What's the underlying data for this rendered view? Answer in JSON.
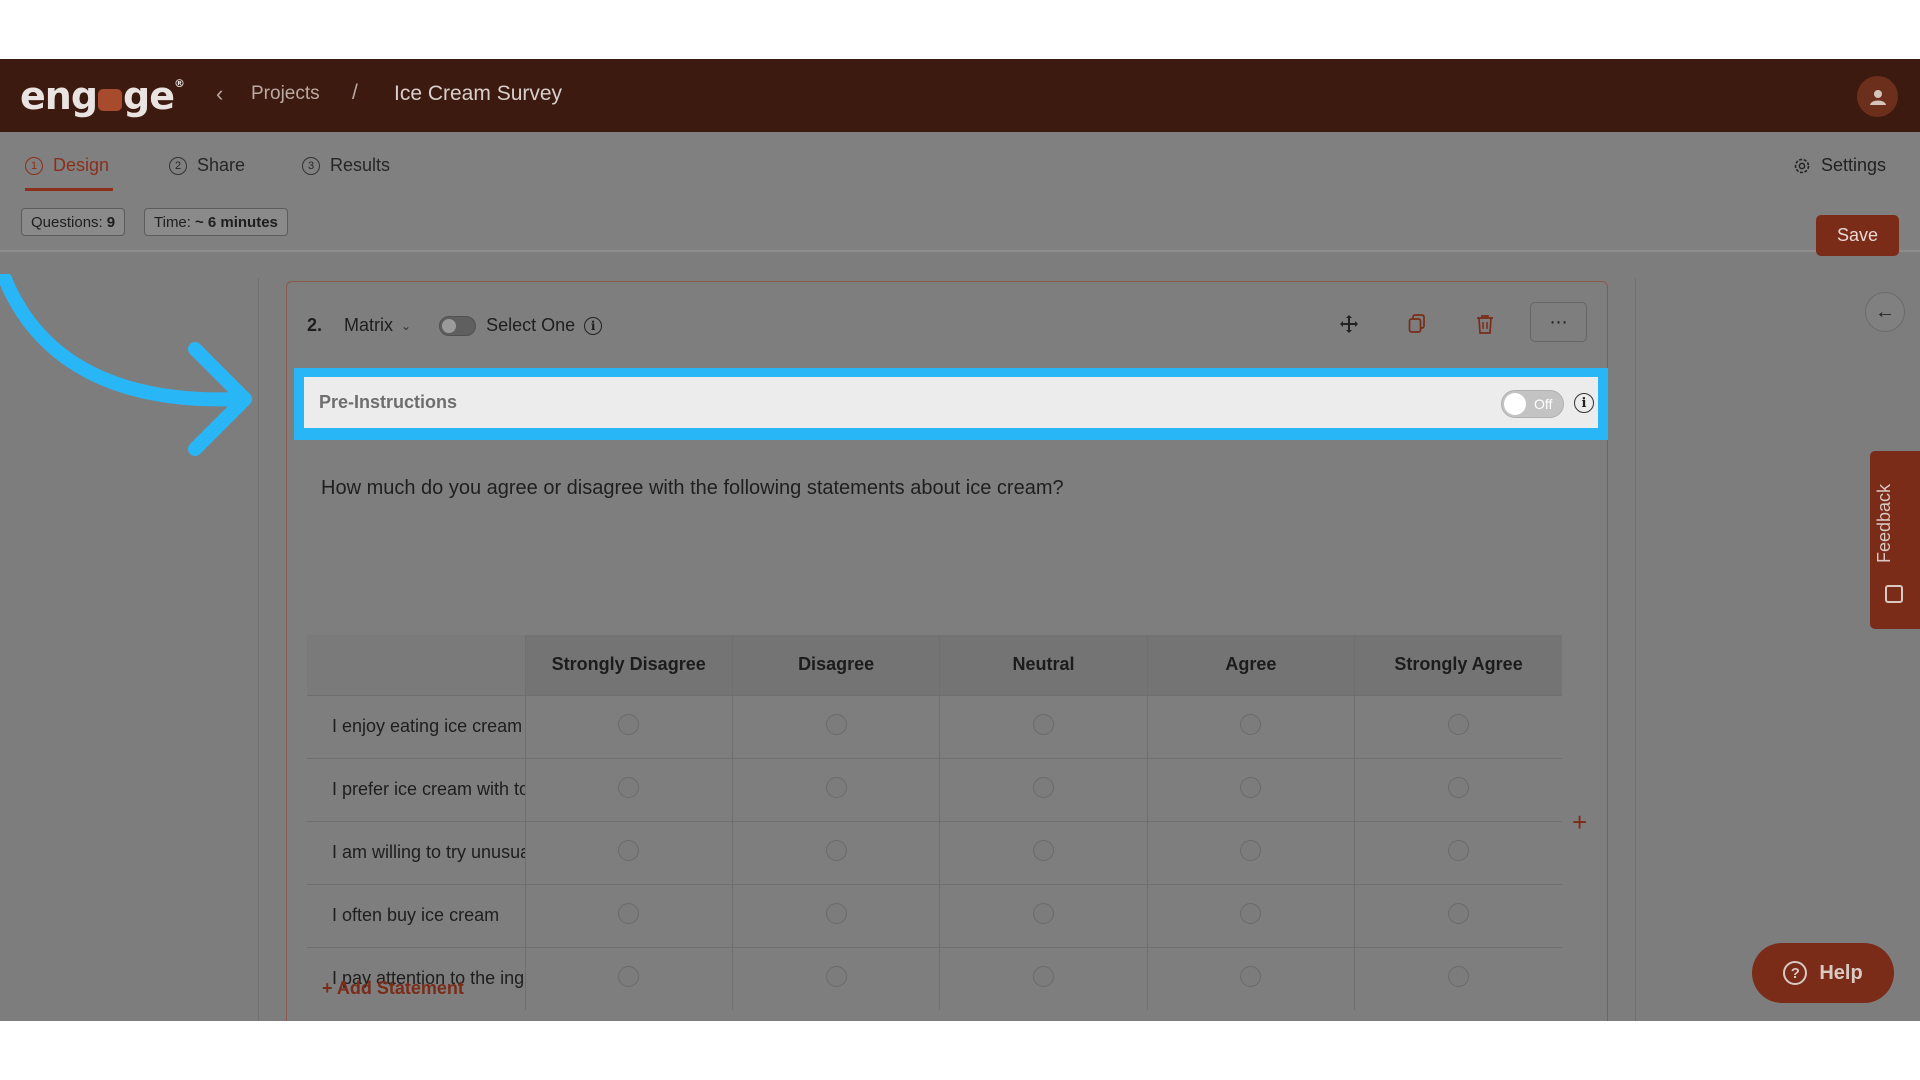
{
  "header": {
    "logo_text": "engage",
    "back_glyph": "‹",
    "breadcrumb_projects": "Projects",
    "breadcrumb_separator": "/",
    "survey_title": "Ice Cream Survey"
  },
  "tabs": [
    {
      "num": "1",
      "label": "Design",
      "active": true
    },
    {
      "num": "2",
      "label": "Share",
      "active": false
    },
    {
      "num": "3",
      "label": "Results",
      "active": false
    }
  ],
  "settings_label": "Settings",
  "stats": {
    "questions_label": "Questions:",
    "questions_value": "9",
    "time_label": "Time:",
    "time_value": "~ 6 minutes"
  },
  "save_label": "Save",
  "question": {
    "number": "2.",
    "type": "Matrix",
    "select_mode_label": "Select One",
    "pre_instructions_label": "Pre-Instructions",
    "pre_instructions_toggle": "Off",
    "text": "How much do you agree or disagree with the following statements about ice cream?",
    "columns": [
      "Strongly Disagree",
      "Disagree",
      "Neutral",
      "Agree",
      "Strongly Agree"
    ],
    "statements": [
      "I enjoy eating ice cream",
      "I prefer ice cream with toppings",
      "I am willing to try unusual flavors",
      "I often buy ice cream",
      "I pay attention to the ingredients"
    ],
    "add_statement_label": "+ Add Statement"
  },
  "feedback_label": "Feedback",
  "help_label": "Help",
  "colors": {
    "brand": "#7a2c18",
    "header": "#3d1a0f",
    "highlight": "#29b6f6"
  }
}
